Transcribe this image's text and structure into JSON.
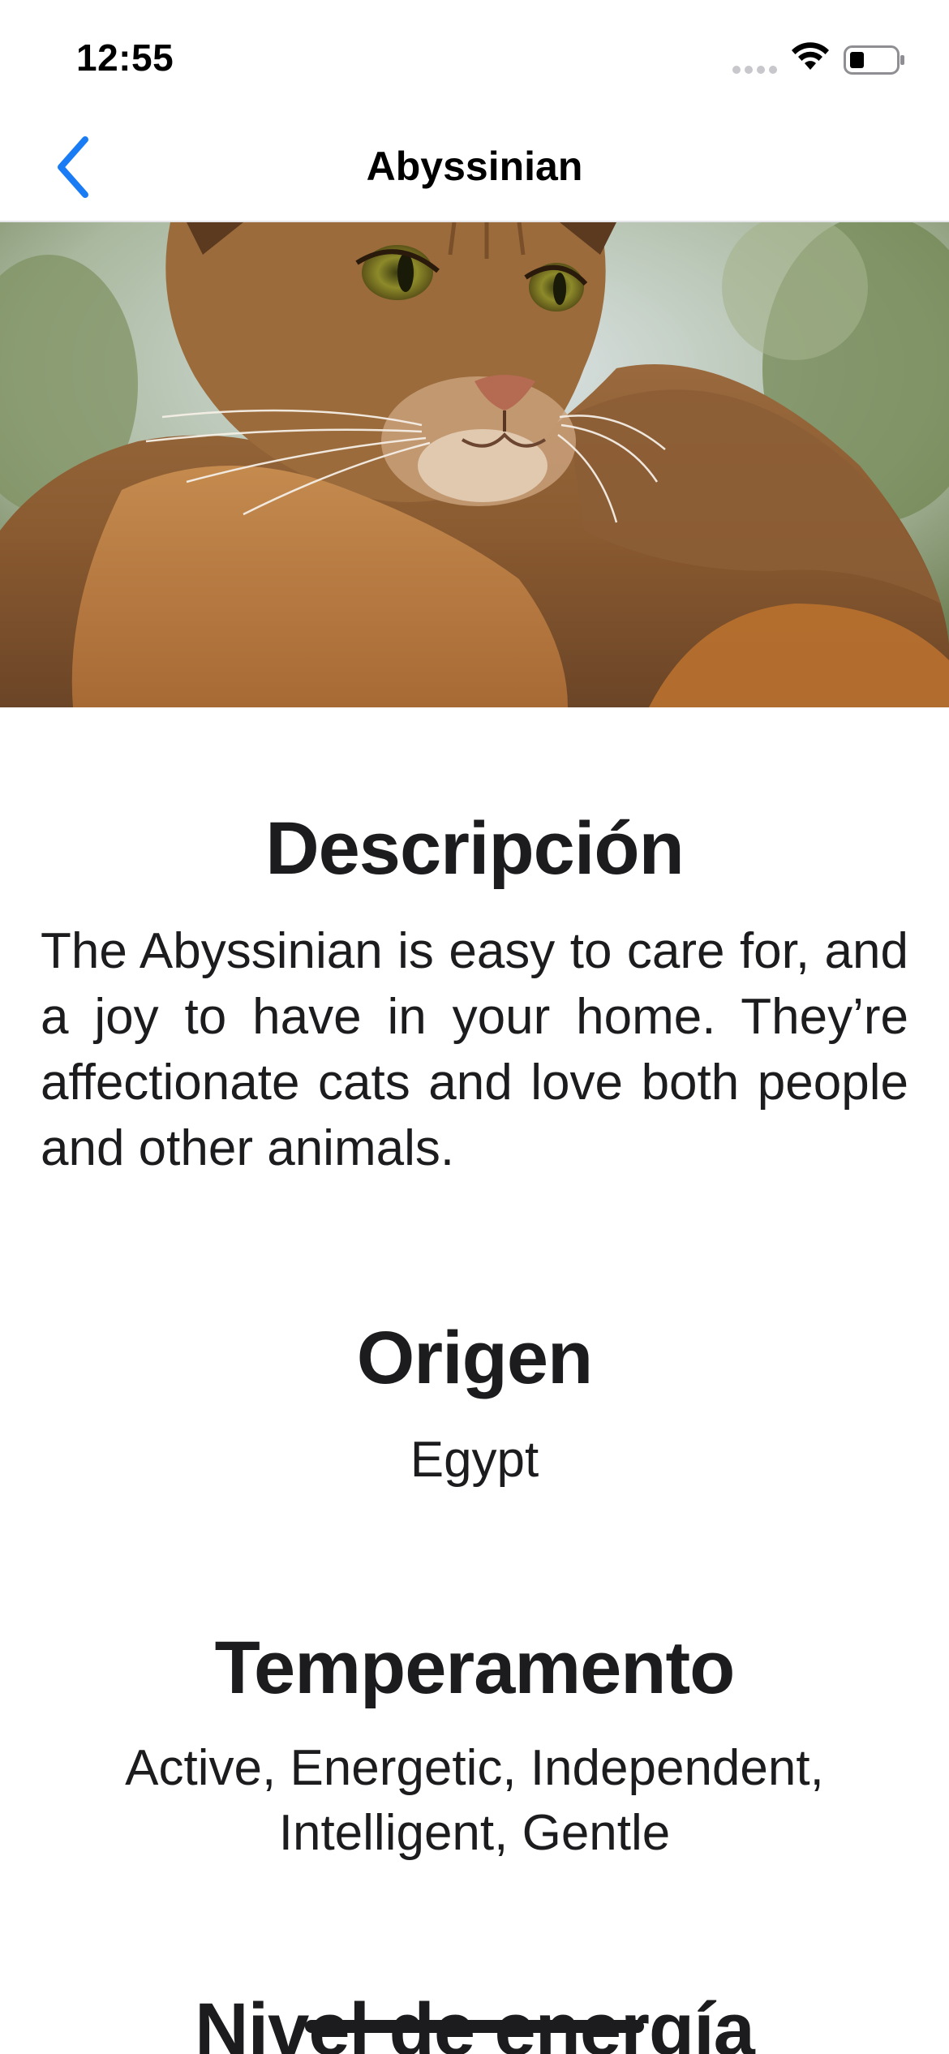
{
  "status_bar": {
    "time": "12:55",
    "icons": [
      "signal-dots-icon",
      "wifi-icon",
      "battery-icon"
    ]
  },
  "nav_bar": {
    "title": "Abyssinian",
    "back_icon": "chevron-left-icon",
    "accent_color": "#1a7cf5"
  },
  "hero_image": {
    "subject": "abyssinian-cat-photo"
  },
  "sections": {
    "description": {
      "heading": "Descripción",
      "body": "The Abyssinian is easy to care for, and a joy to have in your home. They’re affectionate cats and love both people and other animals."
    },
    "origin": {
      "heading": "Origen",
      "body": "Egypt"
    },
    "temperament": {
      "heading": "Temperamento",
      "body_line1": "Active, Energetic, Independent,",
      "body_line2": "Intelligent, Gentle"
    },
    "energy_level": {
      "heading": "Nivel de energía"
    }
  },
  "colors": {
    "text": "#1c1c1e",
    "background": "#ffffff",
    "separator": "#e5e5ea"
  }
}
